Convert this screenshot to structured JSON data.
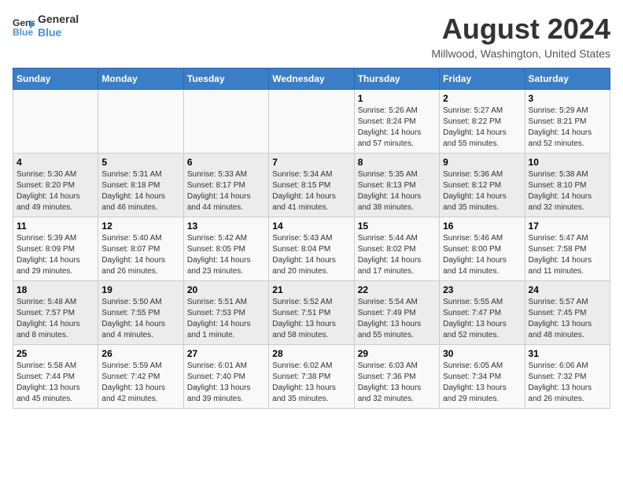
{
  "logo": {
    "line1": "General",
    "line2": "Blue"
  },
  "title": "August 2024",
  "subtitle": "Millwood, Washington, United States",
  "days_of_week": [
    "Sunday",
    "Monday",
    "Tuesday",
    "Wednesday",
    "Thursday",
    "Friday",
    "Saturday"
  ],
  "weeks": [
    [
      {
        "day": "",
        "info": ""
      },
      {
        "day": "",
        "info": ""
      },
      {
        "day": "",
        "info": ""
      },
      {
        "day": "",
        "info": ""
      },
      {
        "day": "1",
        "info": "Sunrise: 5:26 AM\nSunset: 8:24 PM\nDaylight: 14 hours and 57 minutes."
      },
      {
        "day": "2",
        "info": "Sunrise: 5:27 AM\nSunset: 8:22 PM\nDaylight: 14 hours and 55 minutes."
      },
      {
        "day": "3",
        "info": "Sunrise: 5:29 AM\nSunset: 8:21 PM\nDaylight: 14 hours and 52 minutes."
      }
    ],
    [
      {
        "day": "4",
        "info": "Sunrise: 5:30 AM\nSunset: 8:20 PM\nDaylight: 14 hours and 49 minutes."
      },
      {
        "day": "5",
        "info": "Sunrise: 5:31 AM\nSunset: 8:18 PM\nDaylight: 14 hours and 46 minutes."
      },
      {
        "day": "6",
        "info": "Sunrise: 5:33 AM\nSunset: 8:17 PM\nDaylight: 14 hours and 44 minutes."
      },
      {
        "day": "7",
        "info": "Sunrise: 5:34 AM\nSunset: 8:15 PM\nDaylight: 14 hours and 41 minutes."
      },
      {
        "day": "8",
        "info": "Sunrise: 5:35 AM\nSunset: 8:13 PM\nDaylight: 14 hours and 38 minutes."
      },
      {
        "day": "9",
        "info": "Sunrise: 5:36 AM\nSunset: 8:12 PM\nDaylight: 14 hours and 35 minutes."
      },
      {
        "day": "10",
        "info": "Sunrise: 5:38 AM\nSunset: 8:10 PM\nDaylight: 14 hours and 32 minutes."
      }
    ],
    [
      {
        "day": "11",
        "info": "Sunrise: 5:39 AM\nSunset: 8:09 PM\nDaylight: 14 hours and 29 minutes."
      },
      {
        "day": "12",
        "info": "Sunrise: 5:40 AM\nSunset: 8:07 PM\nDaylight: 14 hours and 26 minutes."
      },
      {
        "day": "13",
        "info": "Sunrise: 5:42 AM\nSunset: 8:05 PM\nDaylight: 14 hours and 23 minutes."
      },
      {
        "day": "14",
        "info": "Sunrise: 5:43 AM\nSunset: 8:04 PM\nDaylight: 14 hours and 20 minutes."
      },
      {
        "day": "15",
        "info": "Sunrise: 5:44 AM\nSunset: 8:02 PM\nDaylight: 14 hours and 17 minutes."
      },
      {
        "day": "16",
        "info": "Sunrise: 5:46 AM\nSunset: 8:00 PM\nDaylight: 14 hours and 14 minutes."
      },
      {
        "day": "17",
        "info": "Sunrise: 5:47 AM\nSunset: 7:58 PM\nDaylight: 14 hours and 11 minutes."
      }
    ],
    [
      {
        "day": "18",
        "info": "Sunrise: 5:48 AM\nSunset: 7:57 PM\nDaylight: 14 hours and 8 minutes."
      },
      {
        "day": "19",
        "info": "Sunrise: 5:50 AM\nSunset: 7:55 PM\nDaylight: 14 hours and 4 minutes."
      },
      {
        "day": "20",
        "info": "Sunrise: 5:51 AM\nSunset: 7:53 PM\nDaylight: 14 hours and 1 minute."
      },
      {
        "day": "21",
        "info": "Sunrise: 5:52 AM\nSunset: 7:51 PM\nDaylight: 13 hours and 58 minutes."
      },
      {
        "day": "22",
        "info": "Sunrise: 5:54 AM\nSunset: 7:49 PM\nDaylight: 13 hours and 55 minutes."
      },
      {
        "day": "23",
        "info": "Sunrise: 5:55 AM\nSunset: 7:47 PM\nDaylight: 13 hours and 52 minutes."
      },
      {
        "day": "24",
        "info": "Sunrise: 5:57 AM\nSunset: 7:45 PM\nDaylight: 13 hours and 48 minutes."
      }
    ],
    [
      {
        "day": "25",
        "info": "Sunrise: 5:58 AM\nSunset: 7:44 PM\nDaylight: 13 hours and 45 minutes."
      },
      {
        "day": "26",
        "info": "Sunrise: 5:59 AM\nSunset: 7:42 PM\nDaylight: 13 hours and 42 minutes."
      },
      {
        "day": "27",
        "info": "Sunrise: 6:01 AM\nSunset: 7:40 PM\nDaylight: 13 hours and 39 minutes."
      },
      {
        "day": "28",
        "info": "Sunrise: 6:02 AM\nSunset: 7:38 PM\nDaylight: 13 hours and 35 minutes."
      },
      {
        "day": "29",
        "info": "Sunrise: 6:03 AM\nSunset: 7:36 PM\nDaylight: 13 hours and 32 minutes."
      },
      {
        "day": "30",
        "info": "Sunrise: 6:05 AM\nSunset: 7:34 PM\nDaylight: 13 hours and 29 minutes."
      },
      {
        "day": "31",
        "info": "Sunrise: 6:06 AM\nSunset: 7:32 PM\nDaylight: 13 hours and 26 minutes."
      }
    ]
  ]
}
